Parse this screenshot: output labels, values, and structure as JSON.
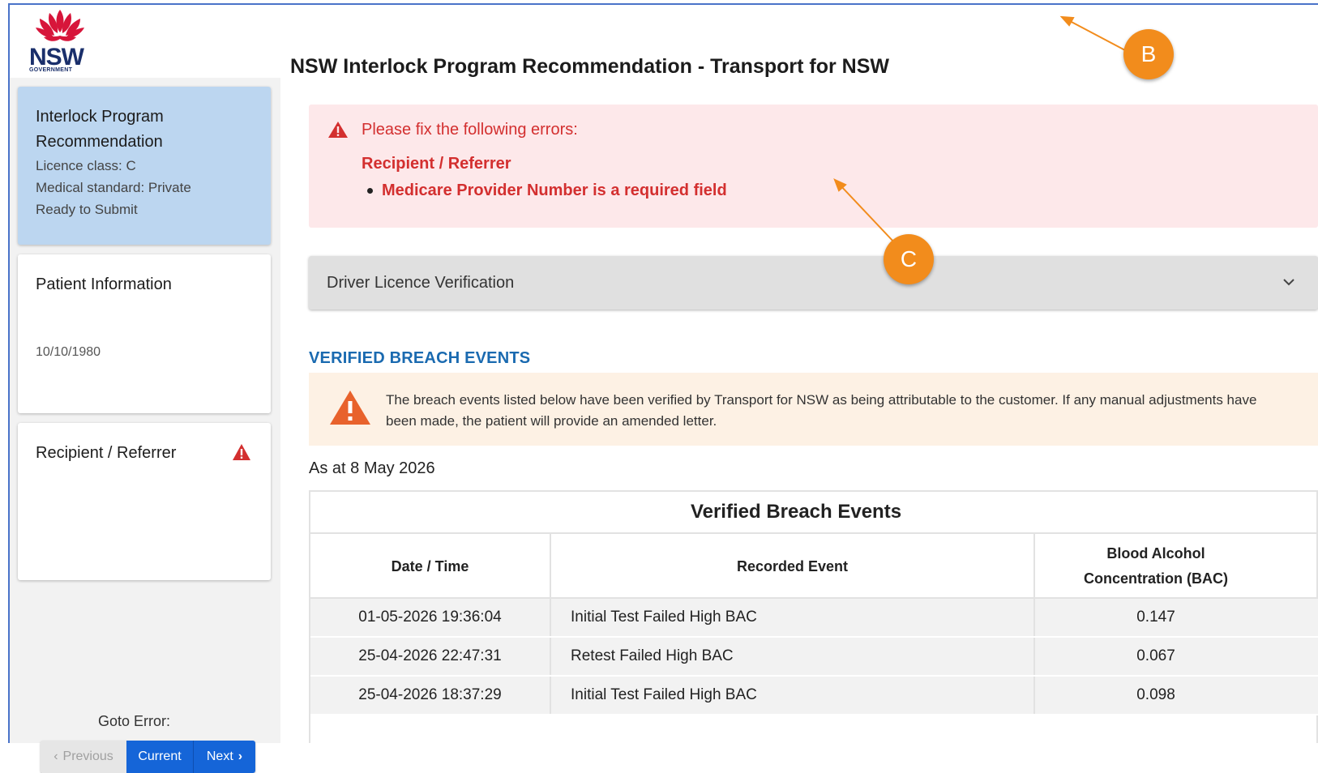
{
  "header": {
    "logo_text": "NSW",
    "logo_subtext": "GOVERNMENT",
    "title": "NSW Interlock Program Recommendation - Transport for NSW"
  },
  "sidebar": {
    "cards": [
      {
        "title_line1": "Interlock Program",
        "title_line2": "Recommendation",
        "licence_class": "Licence class: C",
        "medical_standard": "Medical standard: Private",
        "status": "Ready to Submit"
      },
      {
        "title": "Patient Information",
        "dob": "10/10/1980"
      },
      {
        "title": "Recipient / Referrer",
        "has_error": true
      }
    ],
    "goto_error": {
      "label": "Goto Error:",
      "previous": "Previous",
      "current": "Current",
      "next": "Next"
    }
  },
  "errors": {
    "heading": "Please fix the following errors:",
    "section": "Recipient / Referrer",
    "item": "Medicare Provider Number is a required field"
  },
  "accordion": {
    "label": "Driver Licence Verification",
    "icon": "chevron-down-icon"
  },
  "breach": {
    "heading": "VERIFIED BREACH EVENTS",
    "notice": "The breach events listed below have been verified by Transport for NSW as being attributable to the customer. If any manual adjustments have been made, the patient will provide an amended letter.",
    "as_at": "As at 8 May 2026",
    "table_title": "Verified Breach Events",
    "columns": {
      "datetime": "Date / Time",
      "event": "Recorded Event",
      "bac_line1": "Blood Alcohol",
      "bac_line2": "Concentration (BAC)"
    },
    "rows": [
      {
        "datetime": "01-05-2026 19:36:04",
        "event": "Initial Test Failed High BAC",
        "bac": "0.147"
      },
      {
        "datetime": "25-04-2026 22:47:31",
        "event": "Retest Failed High BAC",
        "bac": "0.067"
      },
      {
        "datetime": "25-04-2026 18:37:29",
        "event": "Initial Test Failed High BAC",
        "bac": "0.098"
      }
    ]
  },
  "callouts": {
    "b": "B",
    "c": "C"
  },
  "colors": {
    "accent_blue": "#1565d8",
    "error_red": "#d32f2f",
    "error_bg": "#fde8ea",
    "active_card": "#bcd6f0",
    "callout_orange": "#f28c1c",
    "heading_blue": "#1a6ab0"
  }
}
